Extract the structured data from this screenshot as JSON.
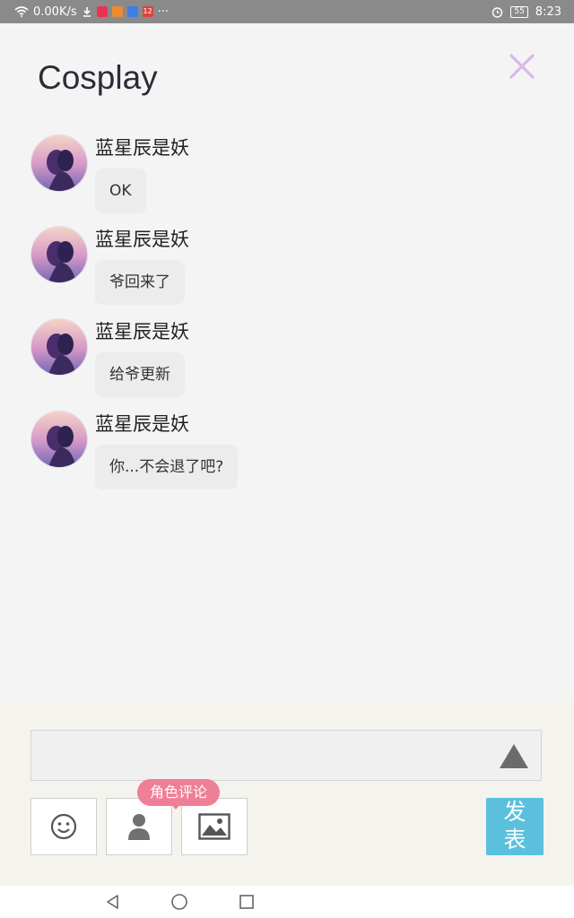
{
  "status_bar": {
    "speed": "0.00K/s",
    "notification_badge": "12",
    "more": "···",
    "battery": "55",
    "time": "8:23"
  },
  "header": {
    "title": "Cosplay",
    "close_icon_color": "#d7b9ea"
  },
  "messages": [
    {
      "user": "蓝星辰是妖",
      "text": "OK"
    },
    {
      "user": "蓝星辰是妖",
      "text": "爷回来了"
    },
    {
      "user": "蓝星辰是妖",
      "text": "给爷更新"
    },
    {
      "user": "蓝星辰是妖",
      "text": "你...不会退了吧?"
    }
  ],
  "composer": {
    "input_value": "",
    "tools": [
      "emoji-icon",
      "person-icon",
      "image-icon"
    ],
    "role_badge": "角色评论",
    "post_label_1": "发",
    "post_label_2": "表",
    "accent": "#5bc0dd",
    "badge_color": "#ef7f96"
  },
  "nav": [
    "back",
    "home",
    "recents"
  ]
}
